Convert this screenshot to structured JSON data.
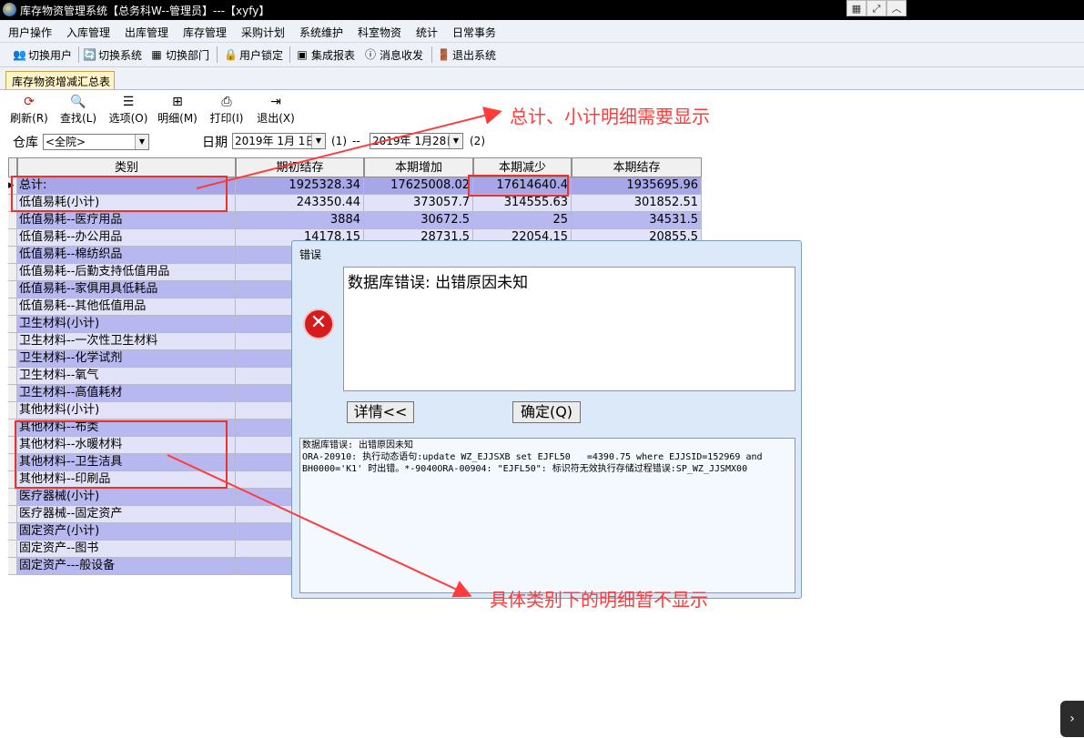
{
  "window": {
    "title": "库存物资管理系统【总务科W--管理员】---【xyfy】"
  },
  "menu": [
    "用户操作",
    "入库管理",
    "出库管理",
    "库存管理",
    "采购计划",
    "系统维护",
    "科室物资",
    "统计",
    "日常事务"
  ],
  "toolbar": {
    "switch_user": "切换用户",
    "switch_system": "切换系统",
    "switch_dept": "切换部门",
    "user_lock": "用户锁定",
    "integrated_report": "集成报表",
    "messages": "消息收发",
    "exit_system": "退出系统"
  },
  "tab": {
    "label": "库存物资增减汇总表"
  },
  "inner_toolbar": {
    "refresh": "刷新(R)",
    "find": "查找(L)",
    "options": "选项(O)",
    "detail": "明细(M)",
    "print": "打印(I)",
    "exit": "退出(X)"
  },
  "filters": {
    "warehouse_label": "仓库",
    "warehouse_value": "<全院>",
    "date_label": "日期",
    "date_from": "2019年 1月 1日",
    "marker1": "(1)",
    "dash": "--",
    "date_to": "2019年 1月28日",
    "marker2": "(2)"
  },
  "grid": {
    "columns": [
      "类别",
      "期初结存",
      "本期增加",
      "本期减少",
      "本期结存"
    ],
    "rows": [
      [
        "总计:",
        "1925328.34",
        "17625008.02",
        "17614640.4",
        "1935695.96"
      ],
      [
        "低值易耗(小计)",
        "243350.44",
        "373057.7",
        "314555.63",
        "301852.51"
      ],
      [
        "低值易耗--医疗用品",
        "3884",
        "30672.5",
        "25",
        "34531.5"
      ],
      [
        "低值易耗--办公用品",
        "14178.15",
        "28731.5",
        "22054.15",
        "20855.5"
      ],
      [
        "低值易耗--棉纺织品",
        "",
        "",
        "",
        ""
      ],
      [
        "低值易耗--后勤支持低值用品",
        "",
        "",
        "",
        ""
      ],
      [
        "低值易耗--家俱用具低耗品",
        "",
        "",
        "",
        ""
      ],
      [
        "低值易耗--其他低值用品",
        "",
        "",
        "",
        ""
      ],
      [
        "卫生材料(小计)",
        "",
        "",
        "",
        ""
      ],
      [
        "卫生材料--一次性卫生材料",
        "",
        "",
        "",
        ""
      ],
      [
        "卫生材料--化学试剂",
        "",
        "",
        "",
        ""
      ],
      [
        "卫生材料--氧气",
        "",
        "",
        "",
        ""
      ],
      [
        "卫生材料--高值耗材",
        "",
        "",
        "",
        ""
      ],
      [
        "其他材料(小计)",
        "",
        "",
        "",
        ""
      ],
      [
        "其他材料--布类",
        "",
        "",
        "",
        ""
      ],
      [
        "其他材料--水暖材料",
        "",
        "",
        "",
        ""
      ],
      [
        "其他材料--卫生洁具",
        "",
        "",
        "",
        ""
      ],
      [
        "其他材料--印刷品",
        "",
        "",
        "",
        ""
      ],
      [
        "医疗器械(小计)",
        "",
        "",
        "",
        ""
      ],
      [
        "医疗器械--固定资产",
        "",
        "",
        "",
        ""
      ],
      [
        "固定资产(小计)",
        "",
        "",
        "",
        ""
      ],
      [
        "固定资产--图书",
        "",
        "",
        "",
        ""
      ],
      [
        "固定资产---般设备",
        "",
        "",
        "",
        ""
      ]
    ]
  },
  "error_dialog": {
    "title": "错误",
    "message": "数据库错误: 出错原因未知",
    "details_button": "详情<<",
    "ok_button": "确定(Q)",
    "detail_text": "数据库错误: 出错原因未知\nORA-20910: 执行动态语句:update WZ_EJJSXB set EJFL50   =4390.75 where EJJSID=152969 and\nBH0000='K1' 时出错。*-9040ORA-00904: \"EJFL50\": 标识符无效执行存储过程错误:SP_WZ_JJSMX00"
  },
  "annotations": {
    "top_note": "总计、小计明细需要显示",
    "bottom_note": "具体类别下的明细暂不显示",
    "color": "#ff3b3b"
  }
}
